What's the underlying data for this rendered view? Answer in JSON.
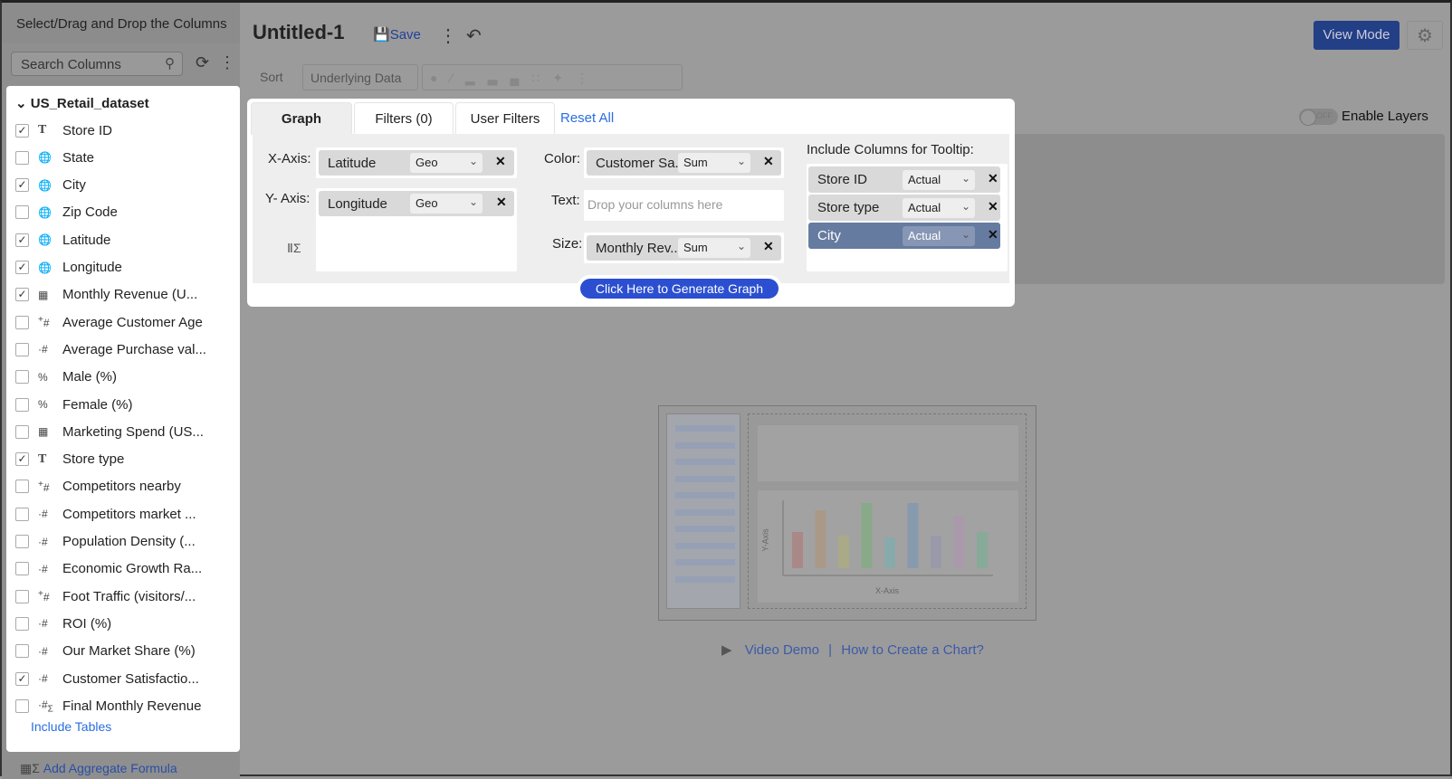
{
  "sidebar": {
    "header": "Select/Drag and Drop the Columns",
    "search_placeholder": "Search Columns",
    "dataset": "US_Retail_dataset",
    "columns": [
      {
        "label": "Store ID",
        "type": "T",
        "checked": true
      },
      {
        "label": "State",
        "type": "geo",
        "checked": false
      },
      {
        "label": "City",
        "type": "geo",
        "checked": true
      },
      {
        "label": "Zip Code",
        "type": "geo",
        "checked": false
      },
      {
        "label": "Latitude",
        "type": "geo",
        "checked": true
      },
      {
        "label": "Longitude",
        "type": "geo",
        "checked": true
      },
      {
        "label": "Monthly Revenue (U...",
        "type": "currency",
        "checked": true
      },
      {
        "label": "Average Customer Age",
        "type": "+#",
        "checked": false
      },
      {
        "label": "Average Purchase val...",
        "type": ".#",
        "checked": false
      },
      {
        "label": "Male (%)",
        "type": "%",
        "checked": false
      },
      {
        "label": "Female (%)",
        "type": "%",
        "checked": false
      },
      {
        "label": "Marketing Spend (US...",
        "type": "currency",
        "checked": false
      },
      {
        "label": "Store type",
        "type": "T",
        "checked": true
      },
      {
        "label": "Competitors nearby",
        "type": "+#",
        "checked": false
      },
      {
        "label": "Competitors market ...",
        "type": ".#",
        "checked": false
      },
      {
        "label": "Population Density (...",
        "type": ".#",
        "checked": false
      },
      {
        "label": "Economic Growth Ra...",
        "type": ".#",
        "checked": false
      },
      {
        "label": "Foot Traffic (visitors/...",
        "type": "+#",
        "checked": false
      },
      {
        "label": "ROI (%)",
        "type": ".#",
        "checked": false
      },
      {
        "label": "Our Market Share (%)",
        "type": ".#",
        "checked": false
      },
      {
        "label": "Customer Satisfactio...",
        "type": ".#",
        "checked": true
      },
      {
        "label": "Final Monthly Revenue",
        "type": ".#Σ",
        "checked": false
      }
    ],
    "include_tables": "Include Tables",
    "add_aggregate": "Add Aggregate Formula"
  },
  "header": {
    "title": "Untitled-1",
    "save": "Save",
    "view_mode": "View Mode"
  },
  "toolbar": {
    "sort": "Sort",
    "underlying": "Underlying Data"
  },
  "layers": {
    "label": "Enable Layers",
    "toggle": "OFF"
  },
  "popup": {
    "tabs": [
      "Graph",
      "Filters  (0)",
      "User Filters"
    ],
    "reset": "Reset All",
    "x_label": "X-Axis:",
    "x_value": "Latitude",
    "x_agg": "Geo",
    "y_label": "Y- Axis:",
    "y_value": "Longitude",
    "y_agg": "Geo",
    "color_label": "Color:",
    "color_value": "Customer Sa...",
    "color_agg": "Sum",
    "text_label": "Text:",
    "text_placeholder": "Drop your columns here",
    "size_label": "Size:",
    "size_value": "Monthly Rev...",
    "size_agg": "Sum",
    "tooltip_label": "Include Columns for Tooltip:",
    "tooltip": [
      {
        "label": "Store ID",
        "agg": "Actual"
      },
      {
        "label": "Store type",
        "agg": "Actual"
      },
      {
        "label": "City",
        "agg": "Actual",
        "selected": true
      }
    ],
    "generate": "Click Here to Generate Graph"
  },
  "placeholder": {
    "video": "Video Demo",
    "sep": "|",
    "howto": "How to Create a Chart?",
    "x_axis": "X-Axis",
    "y_axis": "Y-Axis"
  },
  "colors": {
    "accent": "#2b4fd0",
    "view_mode": "#233f86",
    "selected_tooltip": "#667ba0"
  }
}
